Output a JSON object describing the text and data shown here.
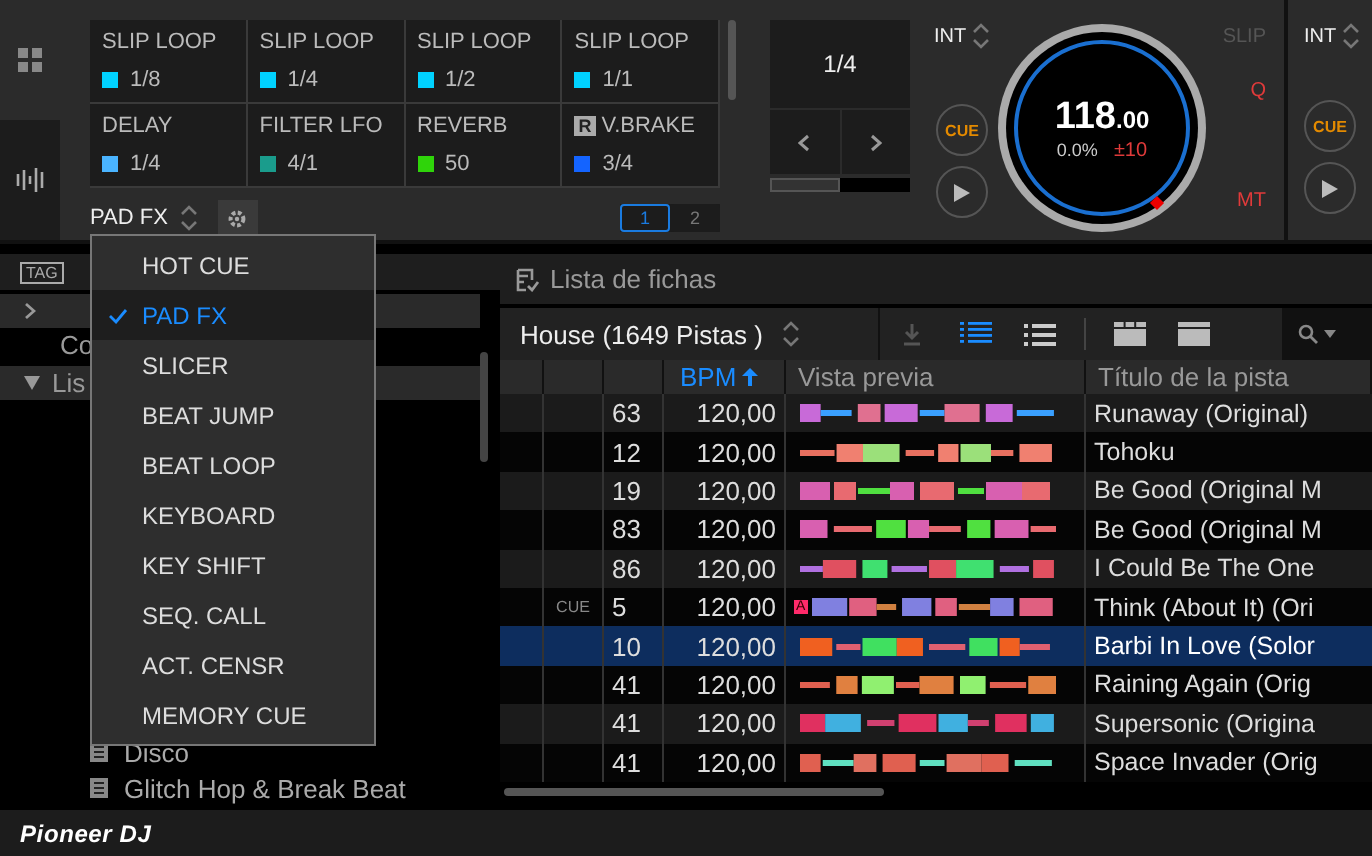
{
  "deck": {
    "pads": [
      {
        "name": "SLIP LOOP",
        "value": "1/8",
        "color": "#00d2ff"
      },
      {
        "name": "SLIP LOOP",
        "value": "1/4",
        "color": "#00d2ff"
      },
      {
        "name": "SLIP LOOP",
        "value": "1/2",
        "color": "#00d2ff"
      },
      {
        "name": "SLIP LOOP",
        "value": "1/1",
        "color": "#00d2ff"
      },
      {
        "name": "DELAY",
        "value": "1/4",
        "color": "#4ab4ff"
      },
      {
        "name": "FILTER LFO",
        "value": "4/1",
        "color": "#1a9c8c"
      },
      {
        "name": "REVERB",
        "value": "50",
        "color": "#2fd40a"
      },
      {
        "name": "V.BRAKE",
        "badge": "R",
        "value": "3/4",
        "color": "#1464ff"
      }
    ],
    "pad_mode": "PAD FX",
    "pages": [
      {
        "label": "1",
        "selected": true
      },
      {
        "label": "2",
        "selected": false
      }
    ],
    "beat": {
      "value": "1/4",
      "level": 0.5
    },
    "sync_mode": "INT",
    "cue": "CUE",
    "bpm": "118",
    "bpm_decimals": ".00",
    "pitch": "0.0%",
    "range": "±10",
    "slip": {
      "label": "SLIP",
      "on": false
    },
    "quantize": {
      "label": "Q",
      "on": true
    },
    "master_tempo": {
      "label": "MT",
      "on": true
    }
  },
  "deck_2": {
    "sync_mode": "INT",
    "cue": "CUE"
  },
  "pad_mode_menu": [
    {
      "label": "HOT CUE",
      "selected": false
    },
    {
      "label": "PAD FX",
      "selected": true
    },
    {
      "label": "SLICER",
      "selected": false
    },
    {
      "label": "BEAT JUMP",
      "selected": false
    },
    {
      "label": "BEAT LOOP",
      "selected": false
    },
    {
      "label": "KEYBOARD",
      "selected": false
    },
    {
      "label": "KEY SHIFT",
      "selected": false
    },
    {
      "label": "SEQ. CALL",
      "selected": false
    },
    {
      "label": "ACT. CENSR",
      "selected": false
    },
    {
      "label": "MEMORY CUE",
      "selected": false
    }
  ],
  "sidebar": {
    "tag": "TAG",
    "items": [
      {
        "expanded": false
      },
      {
        "label": "Co"
      },
      {
        "label": "Lis",
        "expanded": true,
        "children": [
          {
            "label": "Disco"
          },
          {
            "label": "Glitch Hop & Break Beat"
          }
        ]
      }
    ]
  },
  "browser": {
    "title": "Lista de fichas",
    "playlist": "House (1649 Pistas )",
    "views": [
      {
        "selected": true
      },
      {
        "selected": false
      }
    ],
    "columns": [
      {
        "label": "BPM",
        "sorted": true
      },
      {
        "label": "Vista previa",
        "sorted": false
      },
      {
        "label": "Título de la pista",
        "sorted": false
      }
    ],
    "rows": [
      {
        "number": "63",
        "bpm": "120,00",
        "title": "Runaway (Original)",
        "selected": false
      },
      {
        "number": "12",
        "bpm": "120,00",
        "title": "Tohoku",
        "selected": false
      },
      {
        "number": "19",
        "bpm": "120,00",
        "title": "Be Good (Original M",
        "selected": false
      },
      {
        "number": "83",
        "bpm": "120,00",
        "title": "Be Good (Original M",
        "selected": false
      },
      {
        "number": "86",
        "bpm": "120,00",
        "title": "I Could Be The One",
        "selected": false
      },
      {
        "cue": "CUE",
        "marker": "A",
        "number": "5",
        "bpm": "120,00",
        "title": "Think (About It) (Ori",
        "selected": false
      },
      {
        "number": "10",
        "bpm": "120,00",
        "title": "Barbi In Love (Solor",
        "selected": true
      },
      {
        "number": "41",
        "bpm": "120,00",
        "title": "Raining Again (Orig",
        "selected": false
      },
      {
        "number": "41",
        "bpm": "120,00",
        "title": "Supersonic (Origina",
        "selected": false
      },
      {
        "number": "41",
        "bpm": "120,00",
        "title": "Space Invader (Orig",
        "selected": false
      }
    ]
  },
  "footer": {
    "logo": "Pioneer DJ"
  }
}
